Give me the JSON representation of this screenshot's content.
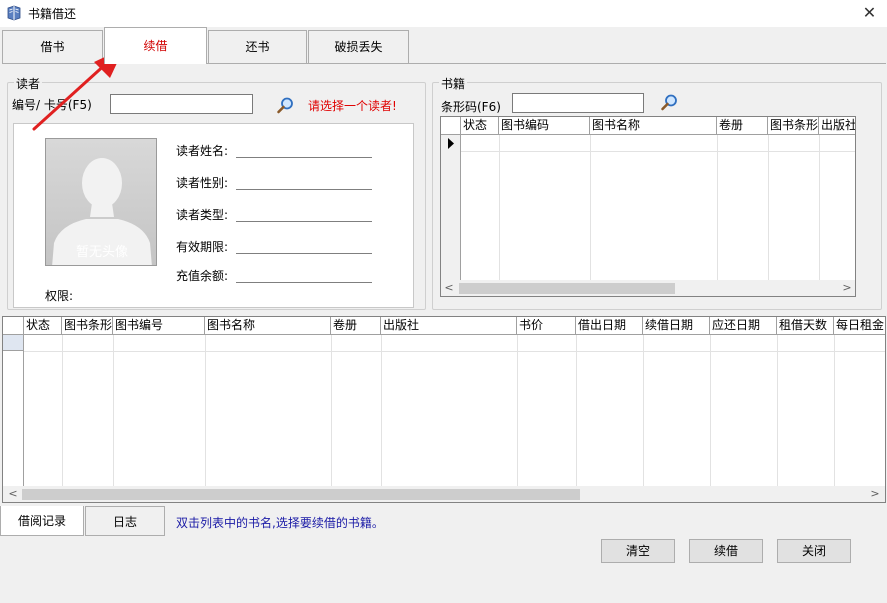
{
  "window": {
    "title": "书籍借还",
    "close_glyph": "✕"
  },
  "tabs": [
    "借书",
    "续借",
    "还书",
    "破损丢失"
  ],
  "active_tab_index": 1,
  "reader": {
    "group_title": "读者",
    "id_label": "编号/ 卡号(F5)",
    "id_value": "",
    "warning": "请选择一个读者!",
    "photo_placeholder": "暂无头像",
    "fields": [
      "读者姓名:",
      "读者性别:",
      "读者类型:",
      "有效期限:",
      "充值余额:"
    ],
    "permission_label": "权限:"
  },
  "book": {
    "group_title": "书籍",
    "barcode_label": "条形码(F6)",
    "barcode_value": "",
    "columns": [
      "状态",
      "图书编码",
      "图书名称",
      "卷册",
      "图书条形",
      "出版社"
    ]
  },
  "records_table": {
    "columns": [
      "状态",
      "图书条形",
      "图书编号",
      "图书名称",
      "卷册",
      "出版社",
      "书价",
      "借出日期",
      "续借日期",
      "应还日期",
      "租借天数",
      "每日租金"
    ]
  },
  "bottom_tabs": [
    "借阅记录",
    "日志"
  ],
  "hint": "双击列表中的书名,选择要续借的书籍。",
  "buttons": {
    "clear": "清空",
    "renew": "续借",
    "close": "关闭"
  },
  "colors": {
    "active_tab": "#d00000",
    "warning": "#e00000",
    "hint": "#1a1aa6",
    "arrow": "#e02020"
  },
  "icons": [
    "app-book-icon",
    "magnifier-icon",
    "avatar-placeholder-icon",
    "annotation-arrow"
  ]
}
